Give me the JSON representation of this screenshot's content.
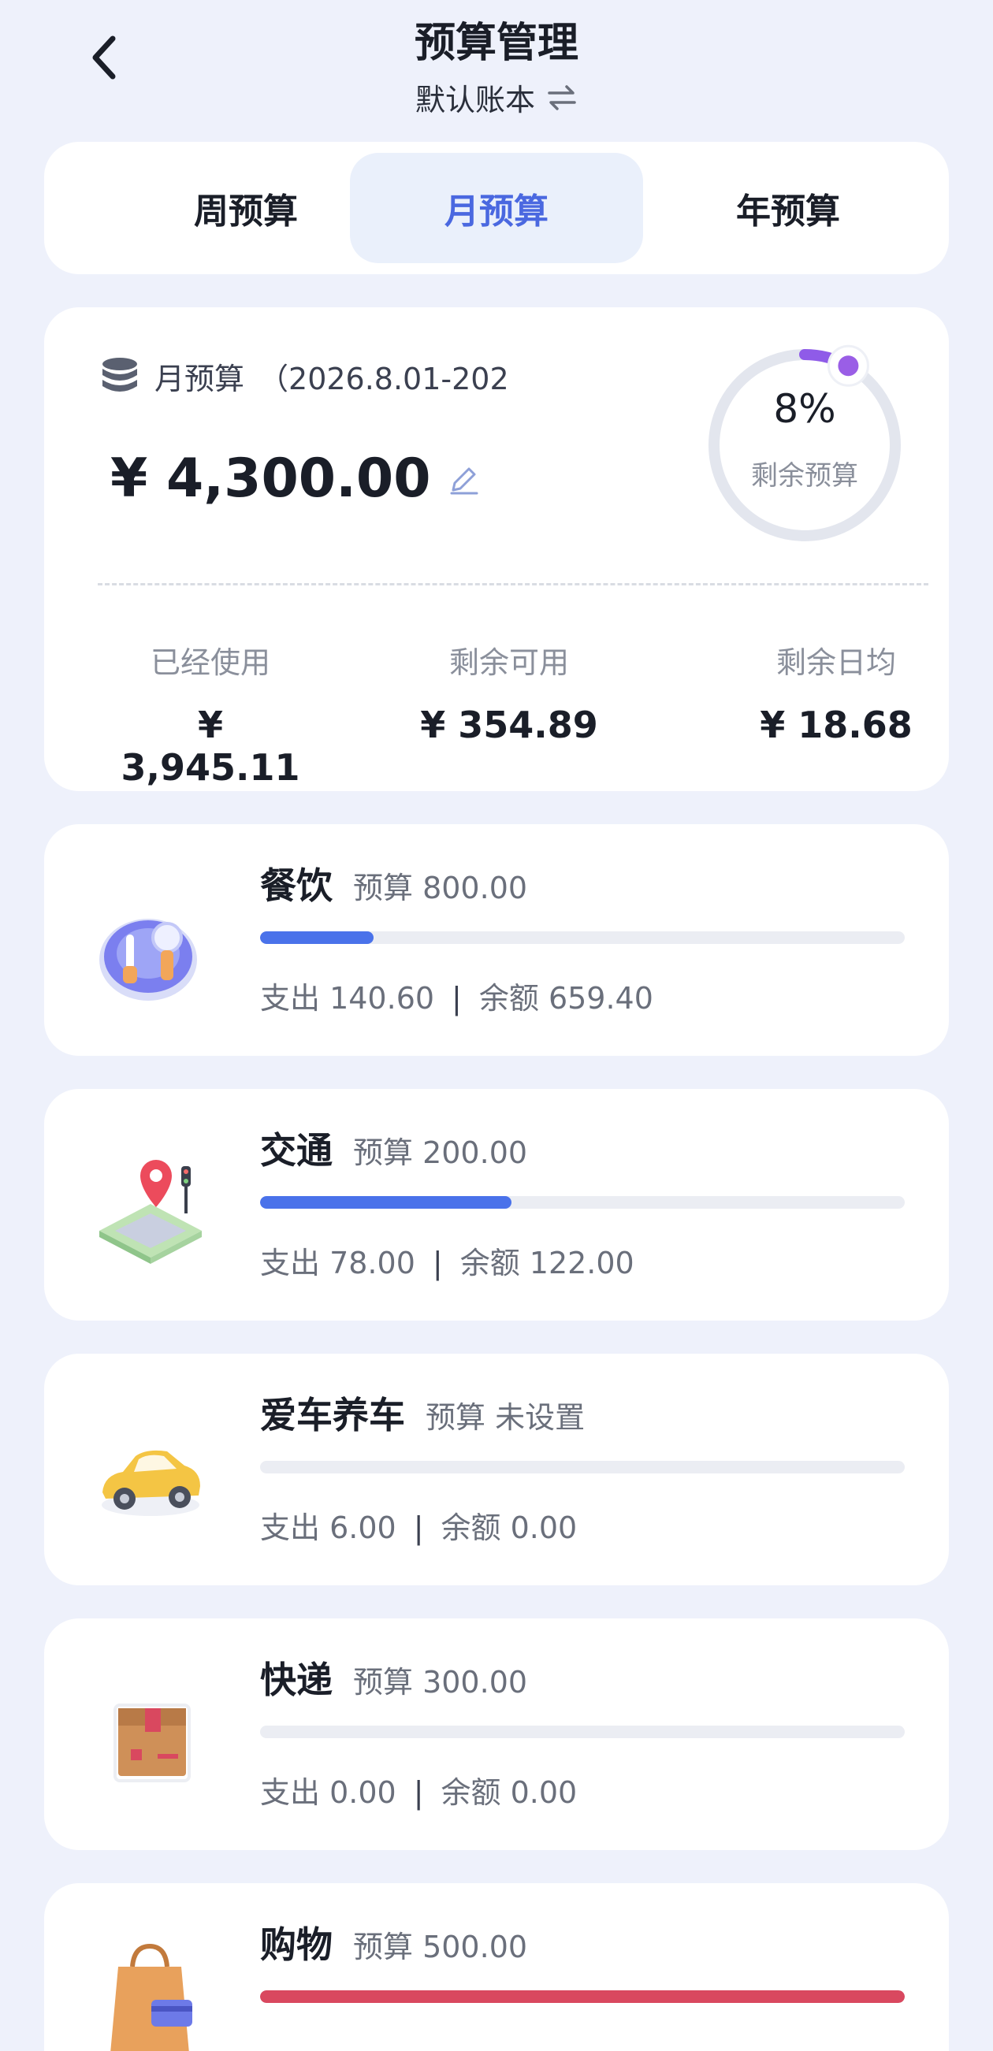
{
  "header": {
    "title": "预算管理",
    "subtitle": "默认账本",
    "switch_icon": "swap-arrows-icon",
    "back_icon": "chevron-left-icon"
  },
  "tabs": [
    {
      "label": "周预算",
      "active": false
    },
    {
      "label": "月预算",
      "active": true
    },
    {
      "label": "年预算",
      "active": false
    }
  ],
  "summary": {
    "label": "月预算",
    "range": "（2026.8.01-202",
    "amount": "¥ 4,300.00",
    "ring_percent": "8%",
    "ring_label": "剩余预算",
    "ring_value": 0.08,
    "stats": [
      {
        "label": "已经使用",
        "value": "¥ 3,945.11"
      },
      {
        "label": "剩余可用",
        "value": "¥ 354.89"
      },
      {
        "label": "剩余日均",
        "value": "¥ 18.68"
      }
    ]
  },
  "categories": [
    {
      "name": "餐饮",
      "budget": "预算 800.00",
      "spend": "支出 140.60",
      "balance": "余额 659.40",
      "progress": 0.176,
      "color": "#4a72ea",
      "icon": "dining-icon"
    },
    {
      "name": "交通",
      "budget": "预算 200.00",
      "spend": "支出 78.00",
      "balance": "余额 122.00",
      "progress": 0.39,
      "color": "#4a72ea",
      "icon": "map-pin-icon"
    },
    {
      "name": "爱车养车",
      "budget": "预算 未设置",
      "spend": "支出 6.00",
      "balance": "余额 0.00",
      "progress": 0,
      "color": "#4a72ea",
      "icon": "car-icon"
    },
    {
      "name": "快递",
      "budget": "预算 300.00",
      "spend": "支出 0.00",
      "balance": "余额 0.00",
      "progress": 0,
      "color": "#4a72ea",
      "icon": "package-icon"
    },
    {
      "name": "购物",
      "budget": "预算 500.00",
      "spend": "",
      "balance": "",
      "progress": 1.0,
      "color": "#d9485f",
      "icon": "shopping-bag-icon"
    }
  ],
  "colors": {
    "accent": "#4a68e0",
    "ring_track": "#e3e6ee",
    "ring_progress": "#8f5be8",
    "over_budget": "#d9485f"
  }
}
